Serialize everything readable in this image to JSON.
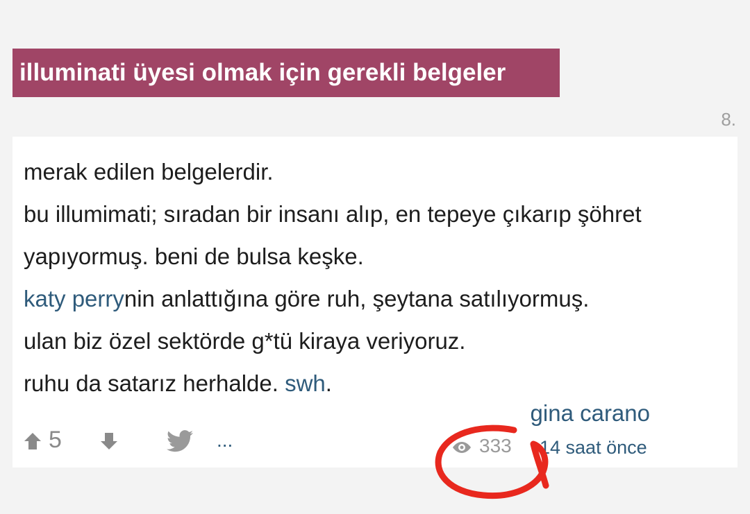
{
  "entry": {
    "title": "illuminati üyesi olmak için gerekli belgeler",
    "number": "8.",
    "content": {
      "line1": "merak edilen belgelerdir.",
      "line2": "bu illumimati; sıradan bir insanı alıp, en tepeye çıkarıp şöhret",
      "line3": "yapıyormuş. beni de bulsa keşke.",
      "line4_link": "katy perry",
      "line4_rest": "nin anlattığına göre ruh, şeytana satılıyormuş.",
      "line5": "ulan biz özel sektörde g*tü kiraya veriyoruz.",
      "line6_text": "ruhu da satarız herhalde. ",
      "line6_link": "swh",
      "line6_end": "."
    },
    "author": "gina carano",
    "votes": "5",
    "more_label": "...",
    "views": "333",
    "time_ago": "14 saat önce"
  },
  "colors": {
    "title_background": "#a04566",
    "link": "#2f5b7b",
    "annotation": "#e8281e"
  },
  "icons": [
    "arrow-up-icon",
    "arrow-down-icon",
    "twitter-icon",
    "eye-icon"
  ]
}
